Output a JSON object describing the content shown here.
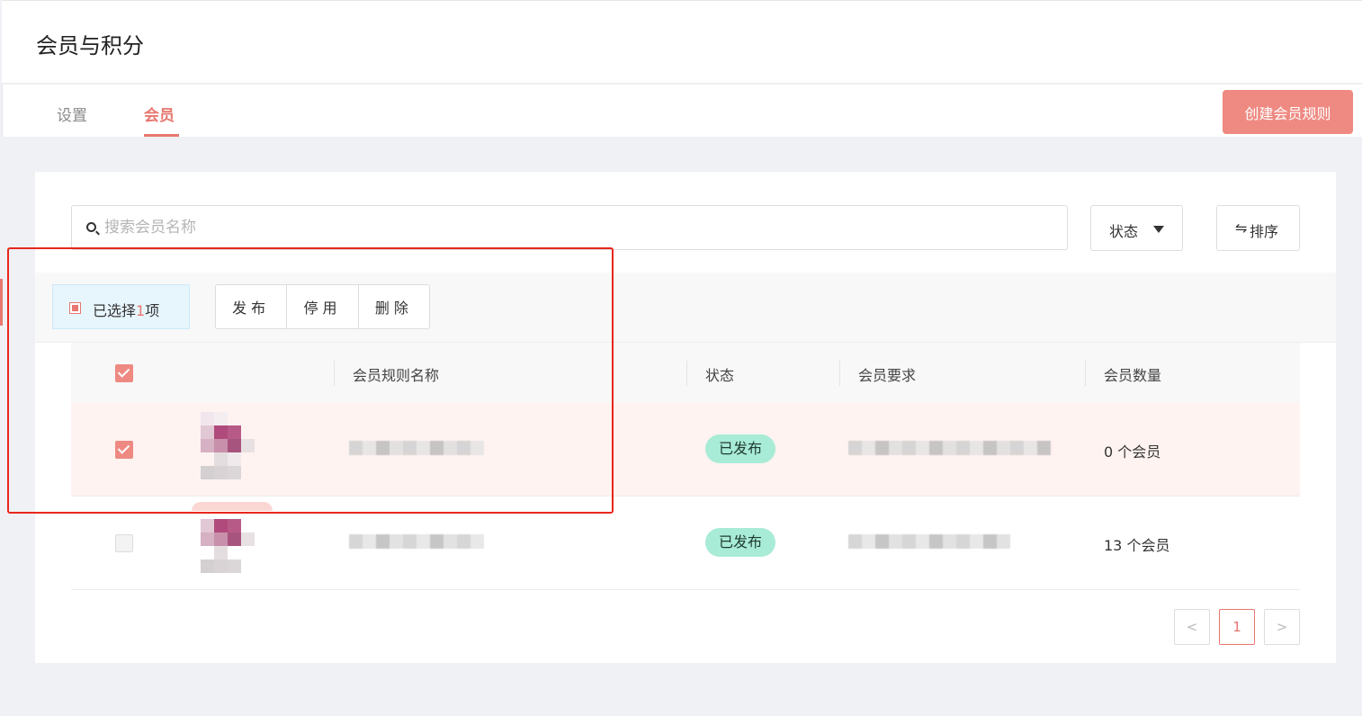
{
  "header": {
    "title": "会员与积分"
  },
  "tabs": [
    {
      "label": "设置",
      "active": false
    },
    {
      "label": "会员",
      "active": true
    }
  ],
  "actions": {
    "create_label": "创建会员规则"
  },
  "search": {
    "placeholder": "搜索会员名称",
    "value": ""
  },
  "filters": {
    "status_label": "状态",
    "sort_icon": "⇋",
    "sort_label": "排序"
  },
  "bulk": {
    "prefix": "已选择",
    "count": "1",
    "suffix": "项",
    "buttons": [
      "发布",
      "停用",
      "删除"
    ]
  },
  "table": {
    "columns": [
      "会员规则名称",
      "状态",
      "会员要求",
      "会员数量"
    ],
    "rows": [
      {
        "selected": true,
        "status": "已发布",
        "count": "0 个会员"
      },
      {
        "selected": false,
        "status": "已发布",
        "count": "13 个会员"
      }
    ]
  },
  "pagination": {
    "prev": "<",
    "current": "1",
    "next": ">"
  },
  "colors": {
    "accent": "#e8776f",
    "badge_bg": "#a8ebd6",
    "selected_row_bg": "#fff3f1",
    "annotation": "#e8261c"
  }
}
